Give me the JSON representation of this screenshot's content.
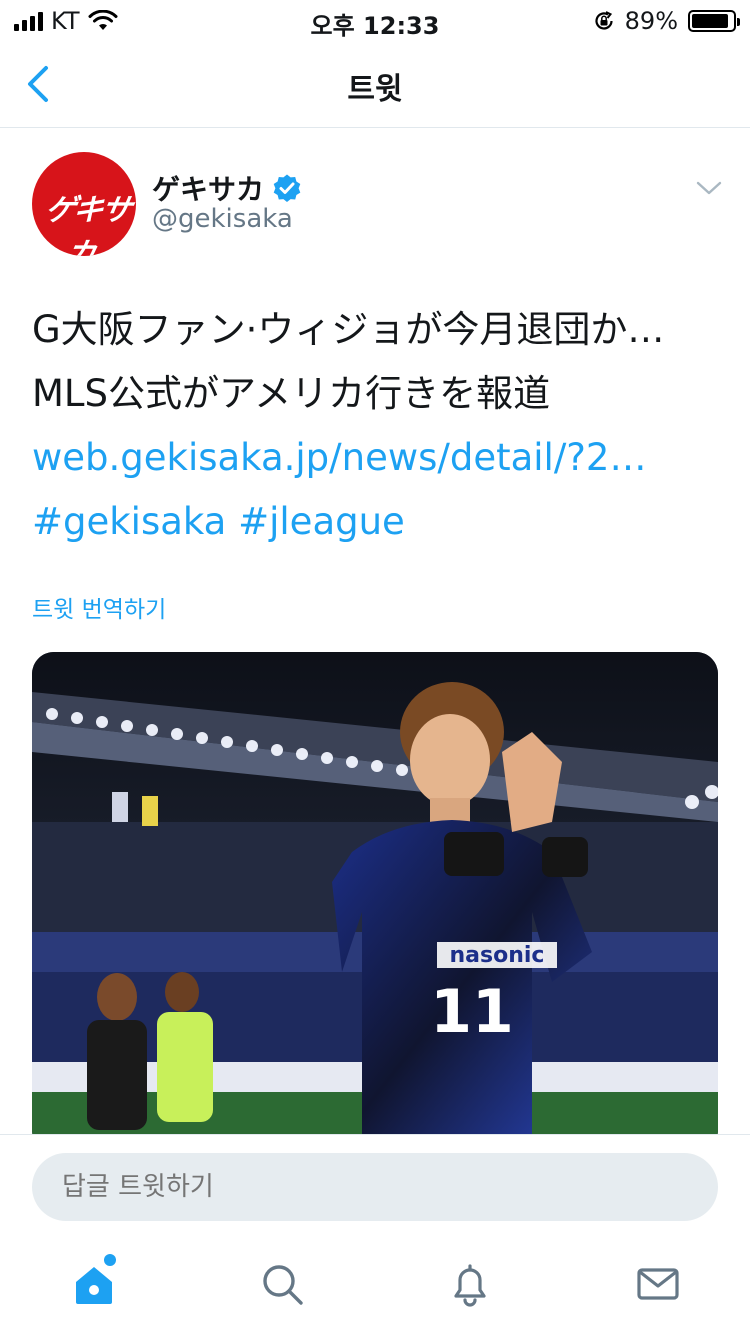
{
  "status_bar": {
    "carrier": "KT",
    "time": "오후 12:33",
    "battery_percent": "89%",
    "battery_level": 0.89
  },
  "nav": {
    "title": "트윗",
    "back_icon": "chevron-left-icon"
  },
  "tweet": {
    "author_name": "ゲキサカ",
    "author_handle": "@gekisaka",
    "avatar_text": "ゲキサカ",
    "verified": true,
    "text_lines": [
      "G大阪ファン·ウィジョが今月退団か…",
      "MLS公式がアメリカ行きを報道"
    ],
    "link": "web.gekisaka.jp/news/detail/?2…",
    "hashtags": "#gekisaka #jleague",
    "translate_label": "트윗 번역하기"
  },
  "reply": {
    "placeholder": "답글 트윗하기"
  },
  "tabs": [
    {
      "name": "home",
      "icon": "home-icon",
      "active": true,
      "has_badge": true
    },
    {
      "name": "search",
      "icon": "search-icon",
      "active": false
    },
    {
      "name": "notifications",
      "icon": "bell-icon",
      "active": false
    },
    {
      "name": "messages",
      "icon": "envelope-icon",
      "active": false
    }
  ],
  "colors": {
    "accent": "#1da1f2",
    "avatar_red": "#d7141a",
    "text": "#14171a",
    "secondary_text": "#657786",
    "divider": "#e1e8ed",
    "input_bg": "#e6ecf0"
  }
}
